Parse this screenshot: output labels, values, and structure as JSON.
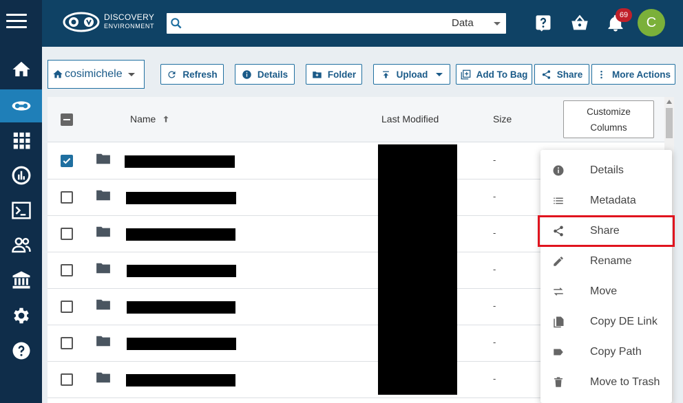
{
  "app": {
    "logo_line1": "DISCOVERY",
    "logo_line2": "ENVIRONMENT"
  },
  "header": {
    "search_placeholder": "",
    "search_scope": "Data",
    "notification_count": "69",
    "avatar_initial": "C"
  },
  "sidebar": {
    "items": [
      {
        "icon": "home-icon",
        "active": false
      },
      {
        "icon": "data-icon",
        "active": true
      },
      {
        "icon": "apps-icon",
        "active": false
      },
      {
        "icon": "analyses-icon",
        "active": false
      },
      {
        "icon": "terminal-icon",
        "active": false
      },
      {
        "icon": "teams-icon",
        "active": false
      },
      {
        "icon": "collections-icon",
        "active": false
      },
      {
        "icon": "settings-icon",
        "active": false
      },
      {
        "icon": "help-icon",
        "active": false
      }
    ]
  },
  "toolbar": {
    "user": "cosimichele",
    "refresh": "Refresh",
    "details": "Details",
    "folder": "Folder",
    "upload": "Upload",
    "add_to_bag": "Add To Bag",
    "share": "Share",
    "more_actions": "More Actions"
  },
  "table": {
    "col_name": "Name",
    "col_modified": "Last Modified",
    "col_size": "Size",
    "customize_line1": "Customize",
    "customize_line2": "Columns",
    "rows": [
      {
        "checked": true,
        "size": "-"
      },
      {
        "checked": false,
        "size": "-"
      },
      {
        "checked": false,
        "size": "-"
      },
      {
        "checked": false,
        "size": "-"
      },
      {
        "checked": false,
        "size": "-"
      },
      {
        "checked": false,
        "size": "-"
      },
      {
        "checked": false,
        "size": "-"
      }
    ]
  },
  "context_menu": {
    "items": [
      {
        "label": "Details",
        "icon": "info-icon"
      },
      {
        "label": "Metadata",
        "icon": "list-icon"
      },
      {
        "label": "Share",
        "icon": "share-icon",
        "highlighted": true
      },
      {
        "label": "Rename",
        "icon": "pencil-icon"
      },
      {
        "label": "Move",
        "icon": "swap-icon"
      },
      {
        "label": "Copy DE Link",
        "icon": "copy-icon"
      },
      {
        "label": "Copy Path",
        "icon": "label-icon"
      },
      {
        "label": "Move to Trash",
        "icon": "trash-icon"
      }
    ]
  },
  "colors": {
    "sidebar_bg": "#0f2d4a",
    "header_bg": "#0f4265",
    "accent": "#1f6fa0",
    "highlight": "#e0141e"
  }
}
